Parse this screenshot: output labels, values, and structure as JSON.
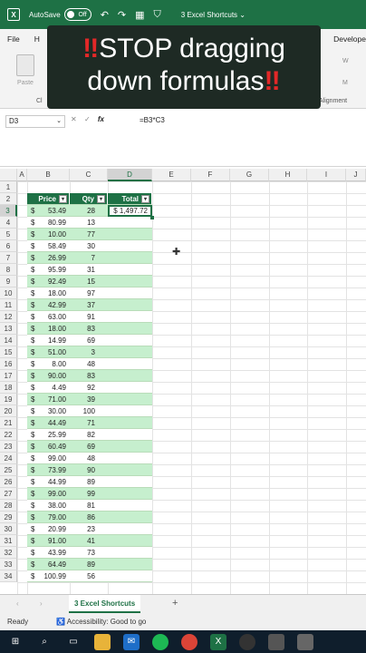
{
  "titlebar": {
    "autosave_label": "AutoSave",
    "toggle_state": "Off",
    "doc_title": "3 Excel Shortcuts ⌄"
  },
  "tabs": {
    "file": "File",
    "home": "H",
    "developer": "Develope"
  },
  "ribbon": {
    "paste_label": "Paste",
    "clip_label": "Cl",
    "align_label": "Alignment",
    "right1": "W",
    "right2": "M"
  },
  "overlay": {
    "line1": "STOP dragging",
    "line2": "down formulas",
    "bang": "‼"
  },
  "formula_bar": {
    "name_box": "D3",
    "fx": "fx",
    "cancel": "✕",
    "enter": "✓",
    "formula": "=B3*C3"
  },
  "columns": [
    "A",
    "B",
    "C",
    "D",
    "E",
    "F",
    "G",
    "H",
    "I",
    "J"
  ],
  "table": {
    "headers": [
      "Price",
      "Qty",
      "Total"
    ],
    "currency_symbol": "$",
    "active_total": "$ 1,497.72",
    "rows": [
      {
        "row": "3",
        "price": "53.49",
        "qty": "28"
      },
      {
        "row": "4",
        "price": "80.99",
        "qty": "13"
      },
      {
        "row": "5",
        "price": "10.00",
        "qty": "77"
      },
      {
        "row": "6",
        "price": "58.49",
        "qty": "30"
      },
      {
        "row": "7",
        "price": "26.99",
        "qty": "7"
      },
      {
        "row": "8",
        "price": "95.99",
        "qty": "31"
      },
      {
        "row": "9",
        "price": "92.49",
        "qty": "15"
      },
      {
        "row": "10",
        "price": "18.00",
        "qty": "97"
      },
      {
        "row": "11",
        "price": "42.99",
        "qty": "37"
      },
      {
        "row": "12",
        "price": "63.00",
        "qty": "91"
      },
      {
        "row": "13",
        "price": "18.00",
        "qty": "83"
      },
      {
        "row": "14",
        "price": "14.99",
        "qty": "69"
      },
      {
        "row": "15",
        "price": "51.00",
        "qty": "3"
      },
      {
        "row": "16",
        "price": "8.00",
        "qty": "48"
      },
      {
        "row": "17",
        "price": "90.00",
        "qty": "83"
      },
      {
        "row": "18",
        "price": "4.49",
        "qty": "92"
      },
      {
        "row": "19",
        "price": "71.00",
        "qty": "39"
      },
      {
        "row": "20",
        "price": "30.00",
        "qty": "100"
      },
      {
        "row": "21",
        "price": "44.49",
        "qty": "71"
      },
      {
        "row": "22",
        "price": "25.99",
        "qty": "82"
      },
      {
        "row": "23",
        "price": "60.49",
        "qty": "69"
      },
      {
        "row": "24",
        "price": "99.00",
        "qty": "48"
      },
      {
        "row": "25",
        "price": "73.99",
        "qty": "90"
      },
      {
        "row": "26",
        "price": "44.99",
        "qty": "89"
      },
      {
        "row": "27",
        "price": "99.00",
        "qty": "99"
      },
      {
        "row": "28",
        "price": "38.00",
        "qty": "81"
      },
      {
        "row": "29",
        "price": "79.00",
        "qty": "86"
      },
      {
        "row": "30",
        "price": "20.99",
        "qty": "23"
      },
      {
        "row": "31",
        "price": "91.00",
        "qty": "41"
      },
      {
        "row": "32",
        "price": "43.99",
        "qty": "73"
      },
      {
        "row": "33",
        "price": "64.49",
        "qty": "89"
      },
      {
        "row": "34",
        "price": "100.99",
        "qty": "56"
      }
    ]
  },
  "row_numbers": [
    "1",
    "2"
  ],
  "sheet_tab": "3 Excel Shortcuts",
  "status": {
    "ready": "Ready",
    "accessibility": "Accessibility: Good to go"
  },
  "colors": {
    "excel_green": "#1e7145",
    "band_green": "#c6efce",
    "taskbar": "#0f1e2c"
  }
}
